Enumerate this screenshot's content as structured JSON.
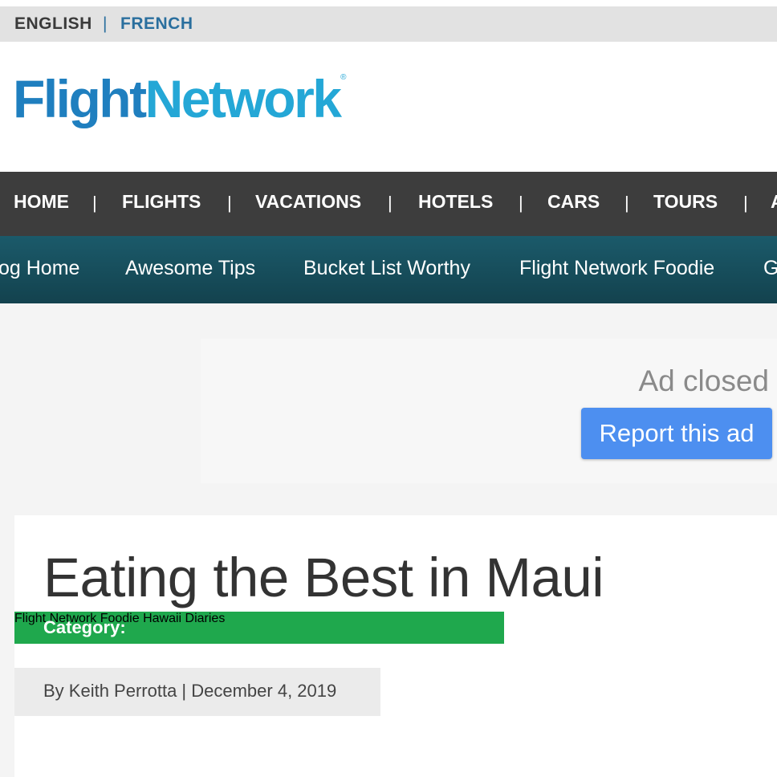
{
  "lang_bar": {
    "english": "ENGLISH",
    "separator": "|",
    "french": "FRENCH"
  },
  "logo": {
    "part1": "Flight",
    "part2": "Network",
    "registered": "®"
  },
  "main_nav": {
    "items": [
      "HOME",
      "FLIGHTS",
      "VACATIONS",
      "HOTELS",
      "CARS",
      "TOURS",
      "A"
    ],
    "separator": "|"
  },
  "sub_nav": {
    "items": [
      "og Home",
      "Awesome Tips",
      "Bucket List Worthy",
      "Flight Network Foodie",
      "G"
    ]
  },
  "ad": {
    "closed_text": "Ad closed",
    "report_label": "Report this ad"
  },
  "article": {
    "title": "Eating the Best in Maui",
    "category_label": "Category:",
    "categories": [
      "Flight Network Foodie",
      "Hawaii Diaries"
    ],
    "byline": "By Keith Perrotta | December 4, 2019"
  },
  "colors": {
    "brand_blue": "#1f7fbf",
    "brand_cyan": "#24a7d6",
    "nav_dark": "#3d3d3d",
    "subnav_teal": "#1b5a6a",
    "category_green": "#1fa84d",
    "report_button": "#4d8ff0"
  }
}
